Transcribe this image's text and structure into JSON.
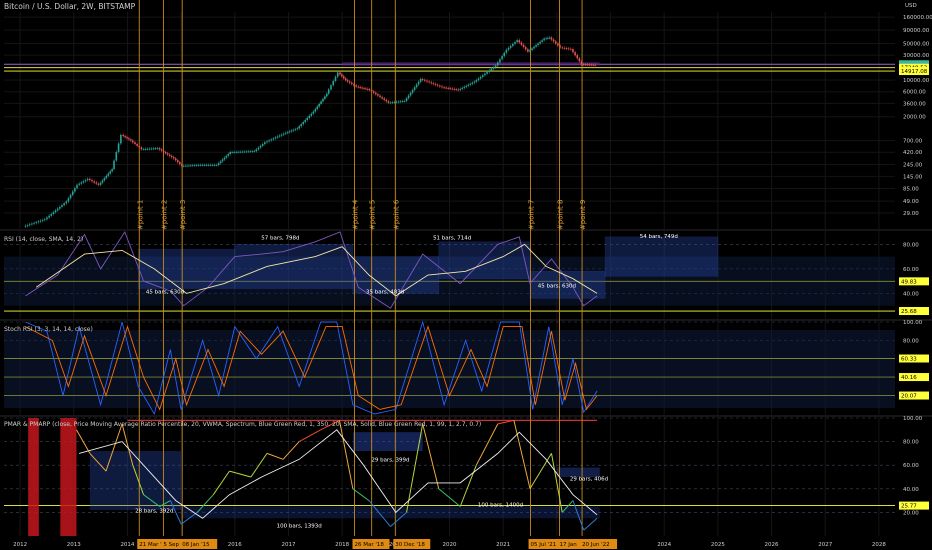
{
  "chart_data": [
    {
      "type": "line",
      "title": "Bitcoin / U.S. Dollar, 2W, BITSTAMP",
      "currency": "USD",
      "scale": "log",
      "ylim": [
        15,
        200000
      ],
      "y_ticks": [
        "160000.00",
        "90000.00",
        "50000.00",
        "30000.00",
        "20000.00",
        "10000.00",
        "6000.00",
        "3600.00",
        "2000.00",
        "700.00",
        "420.00",
        "245.00",
        "145.00",
        "85.00",
        "49.00",
        "29.00"
      ],
      "price_labels": [
        {
          "text": "20091.00",
          "color": "#3bb5a0"
        },
        {
          "text": "54:12h",
          "color": "#3bb5a0"
        },
        {
          "text": "17248.53",
          "color": "#ffff3a"
        },
        {
          "text": "14917.08",
          "color": "#ffff3a"
        }
      ],
      "x_labels": [
        "2012",
        "2013",
        "2014",
        "2015",
        "2016",
        "2017",
        "2018",
        "2019",
        "2020",
        "2021",
        "2022",
        "2023",
        "2024",
        "2025",
        "2026",
        "2027",
        "2028"
      ],
      "x_range": [
        2011.7,
        2028.3
      ],
      "date_highlights": [
        {
          "text": "21 Mar '14",
          "year": 2014.22
        },
        {
          "text": "5 Sep",
          "year": 2014.67
        },
        {
          "text": "08 Jan '15",
          "year": 2015.02
        },
        {
          "text": "26 Mar '18",
          "year": 2018.23
        },
        {
          "text": "30 Dec '18",
          "year": 2018.99
        },
        {
          "text": "05 Jul '21",
          "year": 2021.51
        },
        {
          "text": "17 Jan",
          "year": 2022.05
        },
        {
          "text": "20 Jun '22",
          "year": 2022.47
        }
      ],
      "vertical_markers": [
        {
          "label": "#point 1",
          "year": 2014.22
        },
        {
          "label": "#point 2",
          "year": 2014.67
        },
        {
          "label": "#point 3",
          "year": 2015.02
        },
        {
          "label": "#point 4",
          "year": 2018.23
        },
        {
          "label": "#point 5",
          "year": 2018.55
        },
        {
          "label": "#point 6",
          "year": 2018.99
        },
        {
          "label": "#point 7",
          "year": 2021.51
        },
        {
          "label": "#point 8",
          "year": 2022.05
        },
        {
          "label": "#point 9",
          "year": 2022.47
        }
      ],
      "price_series": [
        {
          "x": 2012.1,
          "y": 16
        },
        {
          "x": 2012.5,
          "y": 22
        },
        {
          "x": 2012.9,
          "y": 48
        },
        {
          "x": 2013.1,
          "y": 100
        },
        {
          "x": 2013.3,
          "y": 130
        },
        {
          "x": 2013.5,
          "y": 100
        },
        {
          "x": 2013.75,
          "y": 200
        },
        {
          "x": 2013.92,
          "y": 900
        },
        {
          "x": 2014.1,
          "y": 700
        },
        {
          "x": 2014.3,
          "y": 480
        },
        {
          "x": 2014.6,
          "y": 500
        },
        {
          "x": 2014.9,
          "y": 320
        },
        {
          "x": 2015.05,
          "y": 230
        },
        {
          "x": 2015.4,
          "y": 240
        },
        {
          "x": 2015.7,
          "y": 240
        },
        {
          "x": 2015.95,
          "y": 420
        },
        {
          "x": 2016.4,
          "y": 440
        },
        {
          "x": 2016.6,
          "y": 650
        },
        {
          "x": 2016.95,
          "y": 950
        },
        {
          "x": 2017.2,
          "y": 1200
        },
        {
          "x": 2017.5,
          "y": 2500
        },
        {
          "x": 2017.75,
          "y": 5500
        },
        {
          "x": 2017.96,
          "y": 14000
        },
        {
          "x": 2018.1,
          "y": 10000
        },
        {
          "x": 2018.3,
          "y": 7500
        },
        {
          "x": 2018.55,
          "y": 6500
        },
        {
          "x": 2018.9,
          "y": 3700
        },
        {
          "x": 2019.2,
          "y": 4000
        },
        {
          "x": 2019.5,
          "y": 10500
        },
        {
          "x": 2019.9,
          "y": 7300
        },
        {
          "x": 2020.2,
          "y": 6500
        },
        {
          "x": 2020.5,
          "y": 9300
        },
        {
          "x": 2020.9,
          "y": 19000
        },
        {
          "x": 2021.1,
          "y": 38000
        },
        {
          "x": 2021.3,
          "y": 58000
        },
        {
          "x": 2021.5,
          "y": 35000
        },
        {
          "x": 2021.8,
          "y": 62000
        },
        {
          "x": 2021.9,
          "y": 65000
        },
        {
          "x": 2022.1,
          "y": 42000
        },
        {
          "x": 2022.3,
          "y": 39000
        },
        {
          "x": 2022.5,
          "y": 20000
        },
        {
          "x": 2022.75,
          "y": 19500
        }
      ],
      "horizontal_levels": [
        {
          "value": 20091,
          "color": "#9b59d6"
        },
        {
          "value": 17248.53,
          "color": "#ffff3a"
        },
        {
          "value": 14917.08,
          "color": "#ffff3a"
        }
      ]
    },
    {
      "type": "line",
      "title": "RSI (14, close, SMA, 14, 2)",
      "ylim": [
        20,
        90
      ],
      "y_ticks": [
        "80.00",
        "60.00",
        "40.00"
      ],
      "level_labels": [
        {
          "text": "49.83",
          "color": "#ffff3a"
        },
        {
          "text": "25.68",
          "color": "#ffff3a"
        }
      ],
      "rsi": [
        {
          "x": 2012.1,
          "y": 38
        },
        {
          "x": 2012.7,
          "y": 55
        },
        {
          "x": 2013.2,
          "y": 88
        },
        {
          "x": 2013.5,
          "y": 60
        },
        {
          "x": 2013.95,
          "y": 90
        },
        {
          "x": 2014.3,
          "y": 50
        },
        {
          "x": 2014.8,
          "y": 42
        },
        {
          "x": 2015.05,
          "y": 30
        },
        {
          "x": 2015.5,
          "y": 45
        },
        {
          "x": 2016.0,
          "y": 70
        },
        {
          "x": 2016.5,
          "y": 72
        },
        {
          "x": 2016.9,
          "y": 74
        },
        {
          "x": 2017.5,
          "y": 82
        },
        {
          "x": 2017.96,
          "y": 90
        },
        {
          "x": 2018.3,
          "y": 45
        },
        {
          "x": 2018.9,
          "y": 28
        },
        {
          "x": 2019.5,
          "y": 72
        },
        {
          "x": 2020.2,
          "y": 48
        },
        {
          "x": 2020.9,
          "y": 80
        },
        {
          "x": 2021.3,
          "y": 86
        },
        {
          "x": 2021.5,
          "y": 48
        },
        {
          "x": 2021.9,
          "y": 68
        },
        {
          "x": 2022.3,
          "y": 45
        },
        {
          "x": 2022.5,
          "y": 30
        },
        {
          "x": 2022.75,
          "y": 38
        }
      ],
      "rsi_ma": [
        {
          "x": 2012.3,
          "y": 45
        },
        {
          "x": 2013.2,
          "y": 72
        },
        {
          "x": 2013.9,
          "y": 75
        },
        {
          "x": 2014.5,
          "y": 60
        },
        {
          "x": 2015.1,
          "y": 40
        },
        {
          "x": 2015.8,
          "y": 48
        },
        {
          "x": 2016.6,
          "y": 62
        },
        {
          "x": 2017.5,
          "y": 70
        },
        {
          "x": 2018.0,
          "y": 78
        },
        {
          "x": 2018.5,
          "y": 55
        },
        {
          "x": 2019.0,
          "y": 38
        },
        {
          "x": 2019.6,
          "y": 55
        },
        {
          "x": 2020.3,
          "y": 58
        },
        {
          "x": 2021.0,
          "y": 70
        },
        {
          "x": 2021.4,
          "y": 80
        },
        {
          "x": 2021.8,
          "y": 62
        },
        {
          "x": 2022.3,
          "y": 52
        },
        {
          "x": 2022.75,
          "y": 40
        }
      ],
      "annotations": [
        {
          "text": "57 bars, 798d",
          "x": 2016.85,
          "y": 84
        },
        {
          "text": "45 bars, 630d",
          "x": 2014.7,
          "y": 40
        },
        {
          "text": "35 bars, 483d",
          "x": 2018.8,
          "y": 40
        },
        {
          "text": "51 bars, 714d",
          "x": 2020.05,
          "y": 84
        },
        {
          "text": "45 bars, 630d",
          "x": 2022.0,
          "y": 45
        },
        {
          "text": "54 bars, 749d",
          "x": 2023.9,
          "y": 85
        }
      ]
    },
    {
      "type": "line",
      "title": "Stoch RSI (3, 3, 14, 14, close)",
      "ylim": [
        0,
        100
      ],
      "y_ticks": [
        "100.00",
        "80.00",
        "20.00"
      ],
      "level_labels": [
        {
          "text": "60.33",
          "color": "#ffff3a"
        },
        {
          "text": "40.16",
          "color": "#ffff3a"
        },
        {
          "text": "20.07",
          "color": "#ffff3a"
        }
      ],
      "k": [
        {
          "x": 2012.1,
          "y": 100
        },
        {
          "x": 2012.5,
          "y": 90
        },
        {
          "x": 2012.8,
          "y": 20
        },
        {
          "x": 2013.1,
          "y": 95
        },
        {
          "x": 2013.5,
          "y": 10
        },
        {
          "x": 2013.9,
          "y": 100
        },
        {
          "x": 2014.2,
          "y": 30
        },
        {
          "x": 2014.5,
          "y": 0
        },
        {
          "x": 2014.8,
          "y": 70
        },
        {
          "x": 2015.0,
          "y": 5
        },
        {
          "x": 2015.4,
          "y": 80
        },
        {
          "x": 2015.7,
          "y": 20
        },
        {
          "x": 2016.0,
          "y": 95
        },
        {
          "x": 2016.4,
          "y": 60
        },
        {
          "x": 2016.8,
          "y": 95
        },
        {
          "x": 2017.2,
          "y": 30
        },
        {
          "x": 2017.6,
          "y": 100
        },
        {
          "x": 2017.9,
          "y": 100
        },
        {
          "x": 2018.2,
          "y": 10
        },
        {
          "x": 2018.6,
          "y": 0
        },
        {
          "x": 2019.0,
          "y": 5
        },
        {
          "x": 2019.5,
          "y": 100
        },
        {
          "x": 2019.9,
          "y": 10
        },
        {
          "x": 2020.3,
          "y": 80
        },
        {
          "x": 2020.6,
          "y": 25
        },
        {
          "x": 2020.95,
          "y": 100
        },
        {
          "x": 2021.3,
          "y": 100
        },
        {
          "x": 2021.55,
          "y": 5
        },
        {
          "x": 2021.85,
          "y": 95
        },
        {
          "x": 2022.1,
          "y": 10
        },
        {
          "x": 2022.3,
          "y": 60
        },
        {
          "x": 2022.5,
          "y": 2
        },
        {
          "x": 2022.75,
          "y": 25
        }
      ],
      "d": [
        {
          "x": 2012.1,
          "y": 95
        },
        {
          "x": 2012.6,
          "y": 80
        },
        {
          "x": 2012.9,
          "y": 30
        },
        {
          "x": 2013.2,
          "y": 85
        },
        {
          "x": 2013.6,
          "y": 20
        },
        {
          "x": 2014.0,
          "y": 95
        },
        {
          "x": 2014.3,
          "y": 40
        },
        {
          "x": 2014.6,
          "y": 5
        },
        {
          "x": 2014.9,
          "y": 60
        },
        {
          "x": 2015.1,
          "y": 10
        },
        {
          "x": 2015.5,
          "y": 70
        },
        {
          "x": 2015.8,
          "y": 30
        },
        {
          "x": 2016.1,
          "y": 90
        },
        {
          "x": 2016.5,
          "y": 65
        },
        {
          "x": 2016.9,
          "y": 90
        },
        {
          "x": 2017.3,
          "y": 40
        },
        {
          "x": 2017.7,
          "y": 95
        },
        {
          "x": 2018.0,
          "y": 95
        },
        {
          "x": 2018.3,
          "y": 20
        },
        {
          "x": 2018.7,
          "y": 5
        },
        {
          "x": 2019.1,
          "y": 10
        },
        {
          "x": 2019.6,
          "y": 95
        },
        {
          "x": 2020.0,
          "y": 20
        },
        {
          "x": 2020.4,
          "y": 70
        },
        {
          "x": 2020.7,
          "y": 30
        },
        {
          "x": 2021.0,
          "y": 95
        },
        {
          "x": 2021.35,
          "y": 95
        },
        {
          "x": 2021.6,
          "y": 10
        },
        {
          "x": 2021.9,
          "y": 90
        },
        {
          "x": 2022.15,
          "y": 15
        },
        {
          "x": 2022.35,
          "y": 55
        },
        {
          "x": 2022.55,
          "y": 5
        },
        {
          "x": 2022.75,
          "y": 20
        }
      ]
    },
    {
      "type": "line",
      "title": "PMAR & PMARP (close, Price Moving Average Ratio Percentile, 20, VWMA, Spectrum, Blue Green Red, 1, 350, 20, SMA, Solid, Blue Green Red, 1, 99, 1, 2.7, 0.7)",
      "ylim": [
        0,
        100
      ],
      "y_ticks": [
        "100.00",
        "80.00",
        "60.00",
        "40.00",
        "20.00"
      ],
      "level_labels": [
        {
          "text": "25.77",
          "color": "#ffff3a"
        }
      ],
      "pmarp": [
        {
          "x": 2013.05,
          "y": 90
        },
        {
          "x": 2013.3,
          "y": 70
        },
        {
          "x": 2013.6,
          "y": 55
        },
        {
          "x": 2013.9,
          "y": 95
        },
        {
          "x": 2014.1,
          "y": 60
        },
        {
          "x": 2014.3,
          "y": 35
        },
        {
          "x": 2014.6,
          "y": 25
        },
        {
          "x": 2014.8,
          "y": 30
        },
        {
          "x": 2015.0,
          "y": 10
        },
        {
          "x": 2015.3,
          "y": 20
        },
        {
          "x": 2015.6,
          "y": 35
        },
        {
          "x": 2015.9,
          "y": 55
        },
        {
          "x": 2016.3,
          "y": 50
        },
        {
          "x": 2016.6,
          "y": 70
        },
        {
          "x": 2016.9,
          "y": 65
        },
        {
          "x": 2017.2,
          "y": 80
        },
        {
          "x": 2017.6,
          "y": 90
        },
        {
          "x": 2017.95,
          "y": 98
        },
        {
          "x": 2018.2,
          "y": 40
        },
        {
          "x": 2018.5,
          "y": 30
        },
        {
          "x": 2018.9,
          "y": 8
        },
        {
          "x": 2019.2,
          "y": 20
        },
        {
          "x": 2019.5,
          "y": 95
        },
        {
          "x": 2019.8,
          "y": 40
        },
        {
          "x": 2020.2,
          "y": 25
        },
        {
          "x": 2020.5,
          "y": 60
        },
        {
          "x": 2020.9,
          "y": 95
        },
        {
          "x": 2021.2,
          "y": 98
        },
        {
          "x": 2021.5,
          "y": 40
        },
        {
          "x": 2021.9,
          "y": 70
        },
        {
          "x": 2022.1,
          "y": 20
        },
        {
          "x": 2022.3,
          "y": 30
        },
        {
          "x": 2022.5,
          "y": 5
        },
        {
          "x": 2022.75,
          "y": 15
        }
      ],
      "signal": [
        {
          "x": 2013.1,
          "y": 70
        },
        {
          "x": 2013.9,
          "y": 80
        },
        {
          "x": 2014.4,
          "y": 55
        },
        {
          "x": 2014.9,
          "y": 30
        },
        {
          "x": 2015.4,
          "y": 15
        },
        {
          "x": 2015.9,
          "y": 35
        },
        {
          "x": 2016.5,
          "y": 50
        },
        {
          "x": 2017.2,
          "y": 65
        },
        {
          "x": 2017.9,
          "y": 90
        },
        {
          "x": 2018.4,
          "y": 60
        },
        {
          "x": 2019.0,
          "y": 20
        },
        {
          "x": 2019.6,
          "y": 45
        },
        {
          "x": 2020.2,
          "y": 45
        },
        {
          "x": 2020.9,
          "y": 70
        },
        {
          "x": 2021.3,
          "y": 88
        },
        {
          "x": 2021.8,
          "y": 65
        },
        {
          "x": 2022.3,
          "y": 35
        },
        {
          "x": 2022.75,
          "y": 18
        }
      ],
      "annotations": [
        {
          "text": "29 bars, 399d",
          "x": 2018.9,
          "y": 63
        },
        {
          "text": "28 bars, 392d",
          "x": 2014.5,
          "y": 20
        },
        {
          "text": "100 bars, 1393d",
          "x": 2017.2,
          "y": 7
        },
        {
          "text": "100 bars, 1400d",
          "x": 2020.95,
          "y": 25
        },
        {
          "text": "29 bars, 406d",
          "x": 2022.6,
          "y": 47
        }
      ]
    }
  ]
}
